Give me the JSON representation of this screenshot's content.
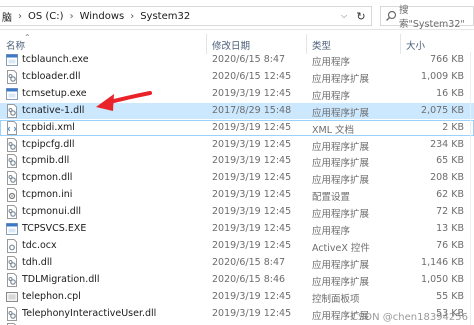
{
  "address_bar": {
    "crumbs": [
      "脑",
      "OS (C:)",
      "Windows",
      "System32"
    ],
    "separator": "›"
  },
  "search": {
    "placeholder": "搜索\"System32\""
  },
  "header": {
    "name": "名称",
    "date": "修改日期",
    "type": "类型",
    "size": "大小"
  },
  "files": [
    {
      "name": "tcblaunch.exe",
      "date": "2020/6/15 8:47",
      "type": "应用程序",
      "size": "766 KB",
      "icon": "exe-icon"
    },
    {
      "name": "tcbloader.dll",
      "date": "2020/6/15 12:45",
      "type": "应用程序扩展",
      "size": "1,009 KB",
      "icon": "dll-icon"
    },
    {
      "name": "tcmsetup.exe",
      "date": "2019/3/19 12:45",
      "type": "应用程序",
      "size": "16 KB",
      "icon": "exe-icon"
    },
    {
      "name": "tcnative-1.dll",
      "date": "2017/8/29 15:48",
      "type": "应用程序扩展",
      "size": "2,075 KB",
      "icon": "dll-icon",
      "selected": true
    },
    {
      "name": "tcpbidi.xml",
      "date": "2019/3/19 12:45",
      "type": "XML 文档",
      "size": "2 KB",
      "icon": "xml-icon",
      "focused": true
    },
    {
      "name": "tcpipcfg.dll",
      "date": "2019/3/19 12:45",
      "type": "应用程序扩展",
      "size": "234 KB",
      "icon": "dll-icon"
    },
    {
      "name": "tcpmib.dll",
      "date": "2019/3/19 12:45",
      "type": "应用程序扩展",
      "size": "65 KB",
      "icon": "dll-icon"
    },
    {
      "name": "tcpmon.dll",
      "date": "2019/3/19 12:45",
      "type": "应用程序扩展",
      "size": "208 KB",
      "icon": "dll-icon"
    },
    {
      "name": "tcpmon.ini",
      "date": "2019/3/19 12:45",
      "type": "配置设置",
      "size": "62 KB",
      "icon": "ini-icon"
    },
    {
      "name": "tcpmonui.dll",
      "date": "2019/3/19 12:45",
      "type": "应用程序扩展",
      "size": "72 KB",
      "icon": "dll-icon"
    },
    {
      "name": "TCPSVCS.EXE",
      "date": "2019/3/19 12:45",
      "type": "应用程序",
      "size": "13 KB",
      "icon": "exe-icon"
    },
    {
      "name": "tdc.ocx",
      "date": "2019/3/19 12:45",
      "type": "ActiveX 控件",
      "size": "76 KB",
      "icon": "ocx-icon"
    },
    {
      "name": "tdh.dll",
      "date": "2020/6/15 8:47",
      "type": "应用程序扩展",
      "size": "1,146 KB",
      "icon": "dll-icon"
    },
    {
      "name": "TDLMigration.dll",
      "date": "2020/6/15 8:46",
      "type": "应用程序扩展",
      "size": "1,050 KB",
      "icon": "dll-icon"
    },
    {
      "name": "telephon.cpl",
      "date": "2019/3/19 12:45",
      "type": "控制面板项",
      "size": "55 KB",
      "icon": "cpl-icon"
    },
    {
      "name": "TelephonyInteractiveUser.dll",
      "date": "2019/3/19 12:45",
      "type": "应用程序扩展",
      "size": "53 KB",
      "icon": "dll-icon"
    },
    {
      "name": "...",
      "date": "2019/3/19 12:45",
      "type": "应用程序扩展",
      "size": "...",
      "icon": "dll-icon"
    }
  ],
  "watermark": "CSDN @chen18394256",
  "colors": {
    "selection": "#cce8ff",
    "annotation_arrow": "#e8232a",
    "header_text": "#4c607a"
  }
}
